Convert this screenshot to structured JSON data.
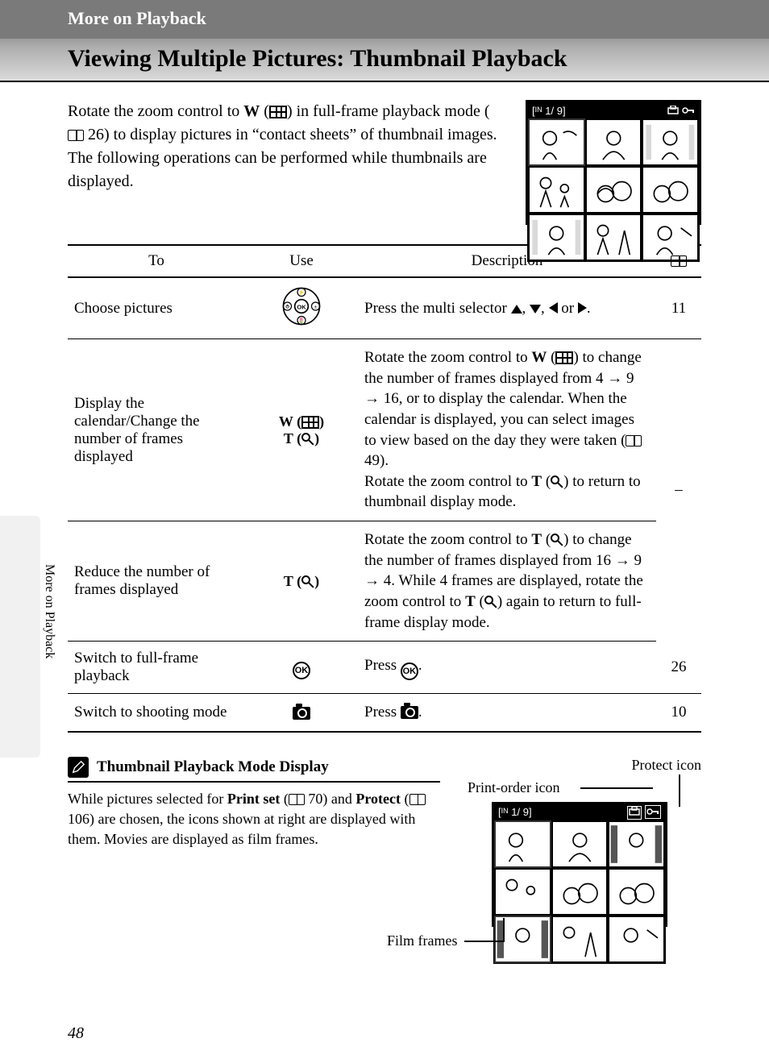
{
  "header": {
    "section": "More on Playback",
    "title": "Viewing Multiple Pictures: Thumbnail Playback"
  },
  "intro": {
    "part1": "Rotate the zoom control to ",
    "w": "W",
    "part2": " in full-frame playback mode (",
    "ref1": "26",
    "part3": ") to display pictures in “contact sheets” of thumbnail images. The following operations can be performed while thumbnails are displayed."
  },
  "lcd": {
    "counter": "1/    9"
  },
  "table": {
    "head": {
      "to": "To",
      "use": "Use",
      "desc": "Description"
    },
    "rows": [
      {
        "to": "Choose pictures",
        "use_type": "selector",
        "desc_pre": "Press the multi selector ",
        "desc_post": ".",
        "ref": "11"
      },
      {
        "to": "Display the calendar/Change the number of frames displayed",
        "use_type": "wt",
        "desc_a": "Rotate the zoom control to ",
        "desc_b": " to change the number of frames displayed from 4 → 9 → 16, or to display the calendar. When the calendar is displayed, you can select images to view based on the day they were taken (",
        "desc_ref": "49",
        "desc_c": ").",
        "desc_d": "Rotate the zoom control to ",
        "desc_e": " to return to thumbnail display mode.",
        "ref": "–"
      },
      {
        "to": "Reduce the number of frames displayed",
        "use_type": "t",
        "desc_a": "Rotate the zoom control to ",
        "desc_b": " to change the number of frames displayed from 16 → 9 → 4. While 4 frames are displayed, rotate the zoom control to ",
        "desc_c": " again to return to full-frame display mode.",
        "ref_merge": true
      },
      {
        "to": "Switch to full-frame playback",
        "use_type": "ok",
        "desc_pre": "Press ",
        "desc_post": ".",
        "ref": "26"
      },
      {
        "to": "Switch to shooting mode",
        "use_type": "camera",
        "desc_pre": "Press ",
        "desc_post": ".",
        "ref": "10"
      }
    ]
  },
  "sidebar": "More on Playback",
  "note": {
    "title": "Thumbnail Playback Mode Display",
    "p1a": "While pictures selected for ",
    "p1b": "Print set",
    "p1c": " (",
    "ref1": "70",
    "p1d": ") and ",
    "p1e": "Protect",
    "p1f": " (",
    "ref2": "106",
    "p1g": ") are chosen, the icons shown at right are displayed with them. Movies are displayed as film frames."
  },
  "annot": {
    "protect": "Protect icon",
    "print": "Print-order icon",
    "film": "Film frames",
    "counter": "1/    9"
  },
  "page_number": "48"
}
